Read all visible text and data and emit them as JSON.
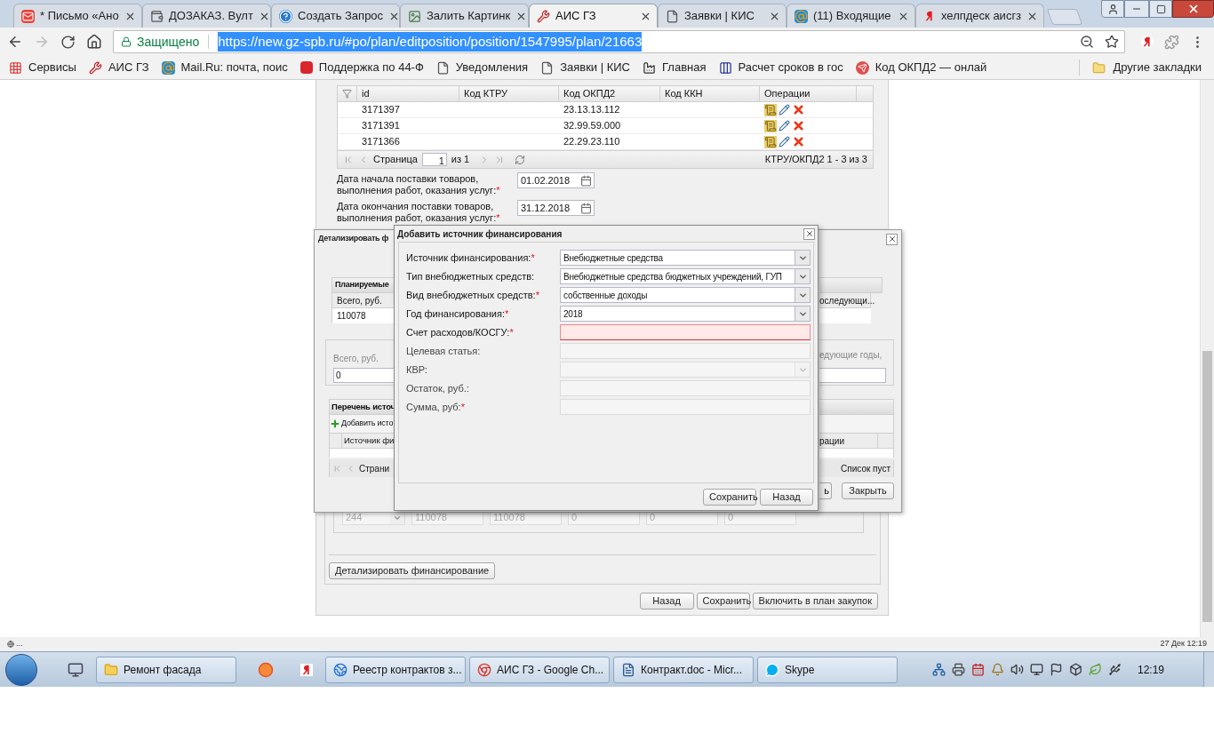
{
  "browser": {
    "tabs": [
      {
        "label": "* Письмо «Ано",
        "kind": "mail",
        "selected": false
      },
      {
        "label": "ДОЗАКАЗ. Вулт",
        "kind": "wallet",
        "selected": false
      },
      {
        "label": "Создать Запрос",
        "kind": "help",
        "selected": false
      },
      {
        "label": "Залить Картинк",
        "kind": "image",
        "selected": false
      },
      {
        "label": "АИС ГЗ",
        "kind": "tool",
        "selected": true
      },
      {
        "label": "Заявки | КИС",
        "kind": "file",
        "selected": false
      },
      {
        "label": "(11) Входящие",
        "kind": "at",
        "selected": false
      },
      {
        "label": "хелпдеск аисгз",
        "kind": "yandex",
        "selected": false
      }
    ],
    "address": {
      "secure_label": "Защищено",
      "url": "https://new.gz-spb.ru/#po/plan/editposition/position/1547995/plan/21663",
      "url_selected": true
    },
    "bookmarks": [
      {
        "label": "Сервисы",
        "kind": "apps"
      },
      {
        "label": "АИС ГЗ",
        "kind": "tool"
      },
      {
        "label": "Mail.Ru: почта, поис",
        "kind": "at"
      },
      {
        "label": "Поддержка по 44-Ф",
        "kind": "badge"
      },
      {
        "label": "Уведомления",
        "kind": "file"
      },
      {
        "label": "Заявки | КИС",
        "kind": "file"
      },
      {
        "label": "Главная",
        "kind": "factory"
      },
      {
        "label": "Расчет сроков в гос",
        "kind": "columns"
      },
      {
        "label": "Код ОКПД2 — онлай",
        "kind": "send"
      }
    ],
    "other_bookmarks": "Другие закладки"
  },
  "page": {
    "grid": {
      "columns": [
        "id",
        "Код КТРУ",
        "Код ОКПД2",
        "Код ККН",
        "Операции"
      ],
      "rows": [
        {
          "id": "3171397",
          "okpd2": "23.13.13.112"
        },
        {
          "id": "3171391",
          "okpd2": "32.99.59.000"
        },
        {
          "id": "3171366",
          "okpd2": "22.29.23.110"
        }
      ],
      "pager": {
        "page_label": "Страница",
        "page": "1",
        "of": "из 1",
        "summary": "КТРУ/ОКПД2 1 - 3 из 3"
      }
    },
    "date_fields": [
      {
        "label": "Дата начала поставки товаров, выполнения работ, оказания услуг:",
        "mark": "*",
        "value": "01.02.2018"
      },
      {
        "label": "Дата окончания поставки товаров, выполнения работ, оказания услуг:",
        "mark": "*",
        "value": "31.12.2018"
      }
    ],
    "financing_row": {
      "kvr": "244",
      "values": [
        "110078",
        "110078",
        "0",
        "0",
        "0"
      ]
    },
    "detail_button": "Детализировать финансирование",
    "buttons": [
      "Назад",
      "Сохранить",
      "Включить в план закупок"
    ]
  },
  "detail_dialog": {
    "title": "Детализировать ф",
    "planned_header": "Планируемые",
    "planned_column": "Всего, руб.",
    "planned_column_right": "оследующи...",
    "planned_value": "110078",
    "total_label": "Всего, руб.",
    "total_value": "0",
    "next_years_label": "едующие годы,",
    "sources_header": "Перечень источ",
    "add_button": "Добавить исто",
    "sources_column": "Источник фи",
    "sources_column_right": "рации",
    "pager_label": "Страни",
    "empty_label": "Список пуст",
    "buttons": [
      "ь",
      "Закрыть"
    ]
  },
  "add_dialog": {
    "title": "Добавить источник финансирования",
    "fields": [
      {
        "label": "Источник финансирования:",
        "mark": "*",
        "kind": "select",
        "value": "Внебюджетные средства",
        "disabled": false,
        "invalid": false
      },
      {
        "label": "Тип внебюджетных средств:",
        "kind": "select",
        "value": "Внебюджетные средства бюджетных учреждений, ГУП",
        "disabled": false,
        "invalid": false
      },
      {
        "label": "Вид внебюджетных средств:",
        "mark": "*",
        "kind": "select",
        "value": "собственные доходы",
        "disabled": false,
        "invalid": false
      },
      {
        "label": "Год финансирования:",
        "mark": "*",
        "kind": "select",
        "value": "2018",
        "disabled": false,
        "invalid": false
      },
      {
        "label": "Счет расходов/КОСГУ:",
        "mark": "*",
        "kind": "text",
        "disabled": false,
        "invalid": true
      },
      {
        "label": "Целевая статья:",
        "kind": "text",
        "disabled": true,
        "invalid": false
      },
      {
        "label": "КВР:",
        "kind": "select",
        "disabled": true,
        "invalid": false
      },
      {
        "label": "Остаток, руб.:",
        "kind": "text",
        "disabled": true,
        "invalid": false
      },
      {
        "label": "Сумма, руб:",
        "mark": "*",
        "kind": "text",
        "disabled": true,
        "invalid": false
      }
    ],
    "buttons": [
      "Сохранить",
      "Назад"
    ]
  },
  "status_bar": {
    "text": "...",
    "notification": "27 Дек 12:19"
  },
  "taskbar": {
    "items": [
      {
        "label": "Ремонт фасада",
        "kind": "folder"
      },
      {
        "label": "Реестр контрактов з...",
        "kind": "ie"
      },
      {
        "label": "АИС ГЗ - Google Ch...",
        "kind": "chrome"
      },
      {
        "label": "Контракт.doc - Micr...",
        "kind": "word"
      },
      {
        "label": "Skype",
        "kind": "skype"
      }
    ],
    "clock": "12:19"
  }
}
